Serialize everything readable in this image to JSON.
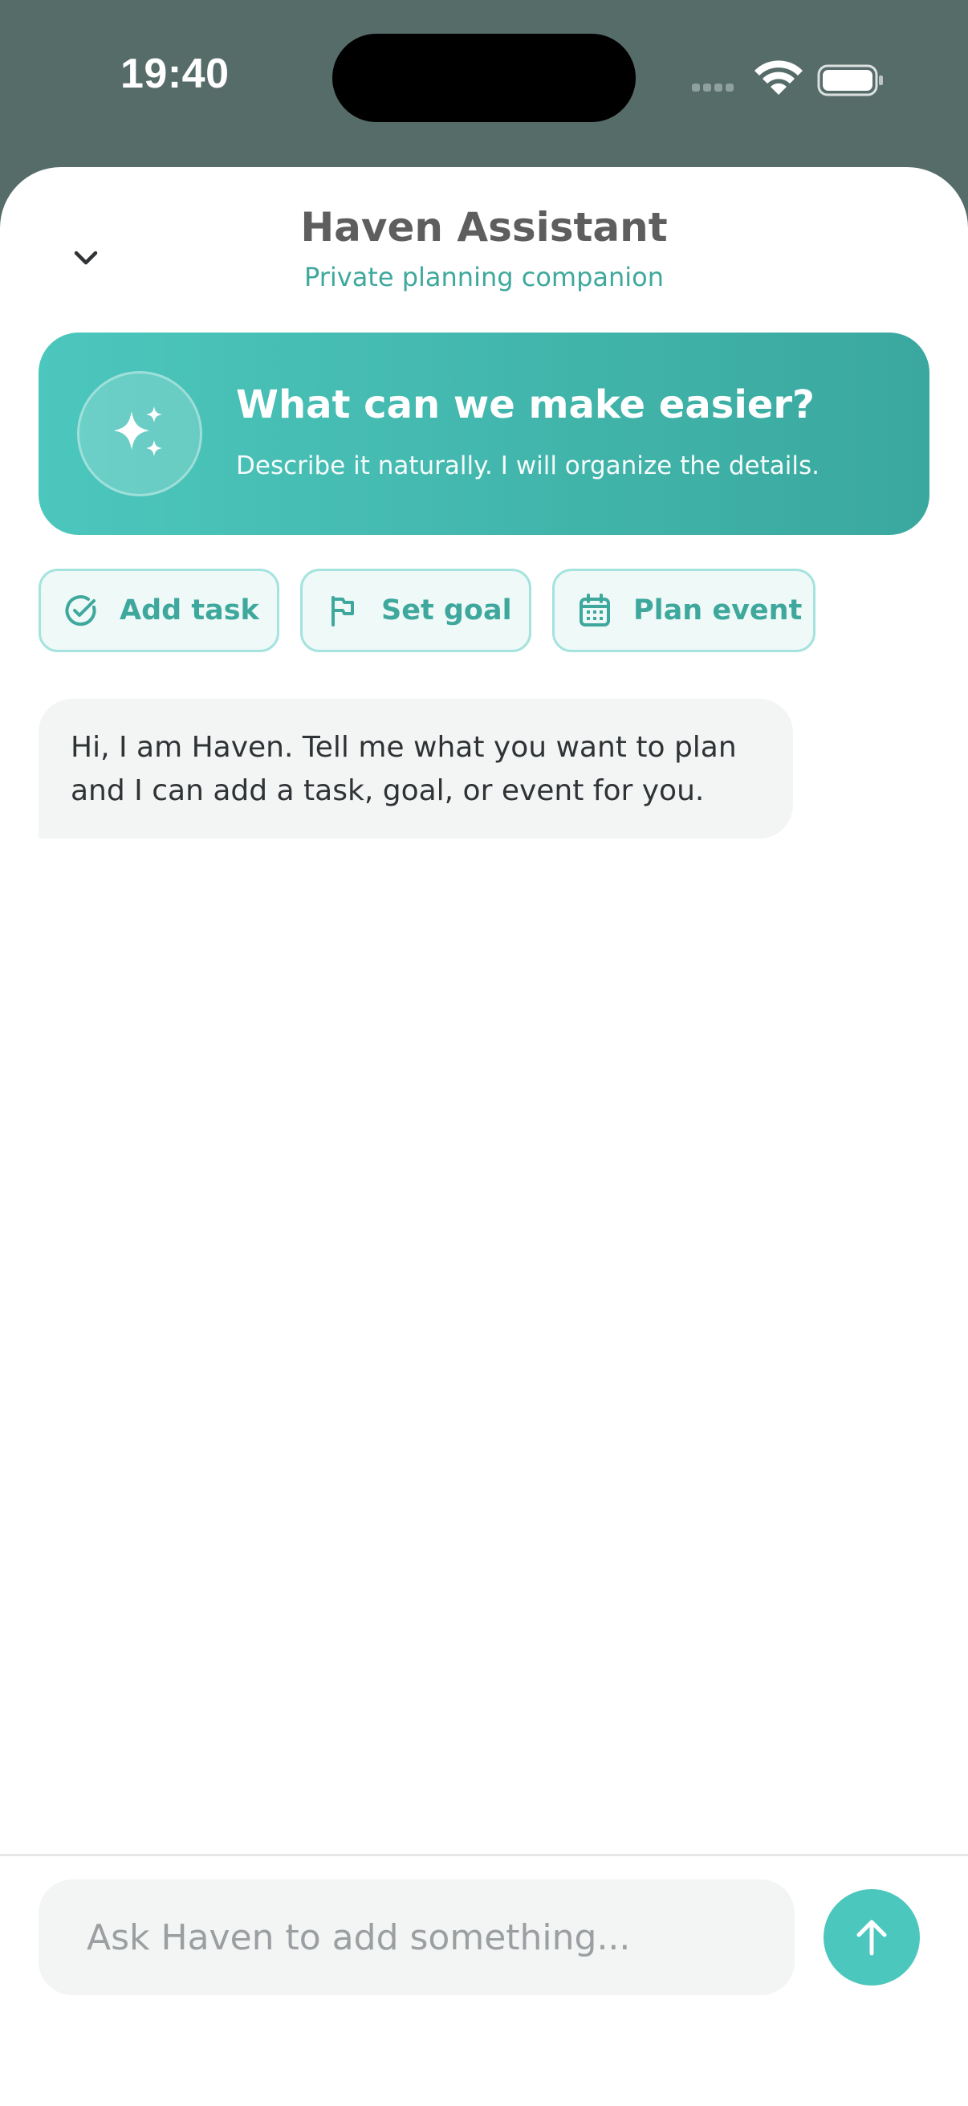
{
  "status_bar": {
    "time": "19:40"
  },
  "header": {
    "title": "Haven Assistant",
    "subtitle": "Private planning companion",
    "collapse_icon": "chevron-down-icon"
  },
  "hero": {
    "icon": "sparkles-icon",
    "title": "What can we make easier?",
    "description": "Describe it naturally. I will organize the details."
  },
  "quick_actions": [
    {
      "label": "Add task",
      "icon": "check-circle-icon"
    },
    {
      "label": "Set goal",
      "icon": "flag-icon"
    },
    {
      "label": "Plan event",
      "icon": "calendar-icon"
    }
  ],
  "messages": [
    {
      "sender": "assistant",
      "text": "Hi, I am Haven. Tell me what you want to plan and I can add a task, goal, or event for you."
    }
  ],
  "composer": {
    "placeholder": "Ask Haven to add something...",
    "value": "",
    "send_icon": "arrow-up-icon"
  },
  "colors": {
    "accent": "#4cc7bd",
    "accent_dark": "#3fa89d",
    "status_bar_bg": "#566c68"
  }
}
